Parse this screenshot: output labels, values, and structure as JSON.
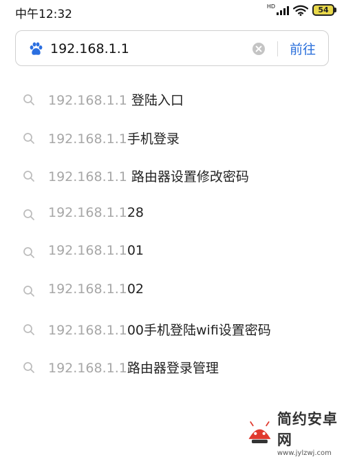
{
  "status_bar": {
    "time": "中午12:32",
    "network_label": "HD",
    "battery_level": "54"
  },
  "search": {
    "value": "192.168.1.1",
    "go_label": "前往"
  },
  "suggestions": [
    {
      "query": "192.168.1.1",
      "completion": " 登陆入口"
    },
    {
      "query": "192.168.1.1",
      "completion": "手机登录"
    },
    {
      "query": "192.168.1.1",
      "completion": " 路由器设置修改密码"
    },
    {
      "query": "192.168.1.1",
      "completion": "28"
    },
    {
      "query": "192.168.1.1",
      "completion": "01"
    },
    {
      "query": "192.168.1.1",
      "completion": "02"
    },
    {
      "query": "192.168.1.1",
      "completion": "00手机登陆wifi设置密码"
    },
    {
      "query": "192.168.1.1",
      "completion": "路由器登录管理"
    }
  ],
  "watermark": {
    "name": "简约安卓网",
    "url": "www.jylzwj.com"
  },
  "colors": {
    "accent": "#2a6fdb",
    "query_text": "#a7a7a7",
    "completion_text": "#222222",
    "paw_icon": "#2b6fe0"
  },
  "icons": {
    "search_engine": "paw-icon",
    "clear": "clear-icon",
    "suggestion": "magnifier-icon",
    "wifi": "wifi-icon",
    "signal": "signal-icon",
    "battery": "battery-icon"
  }
}
